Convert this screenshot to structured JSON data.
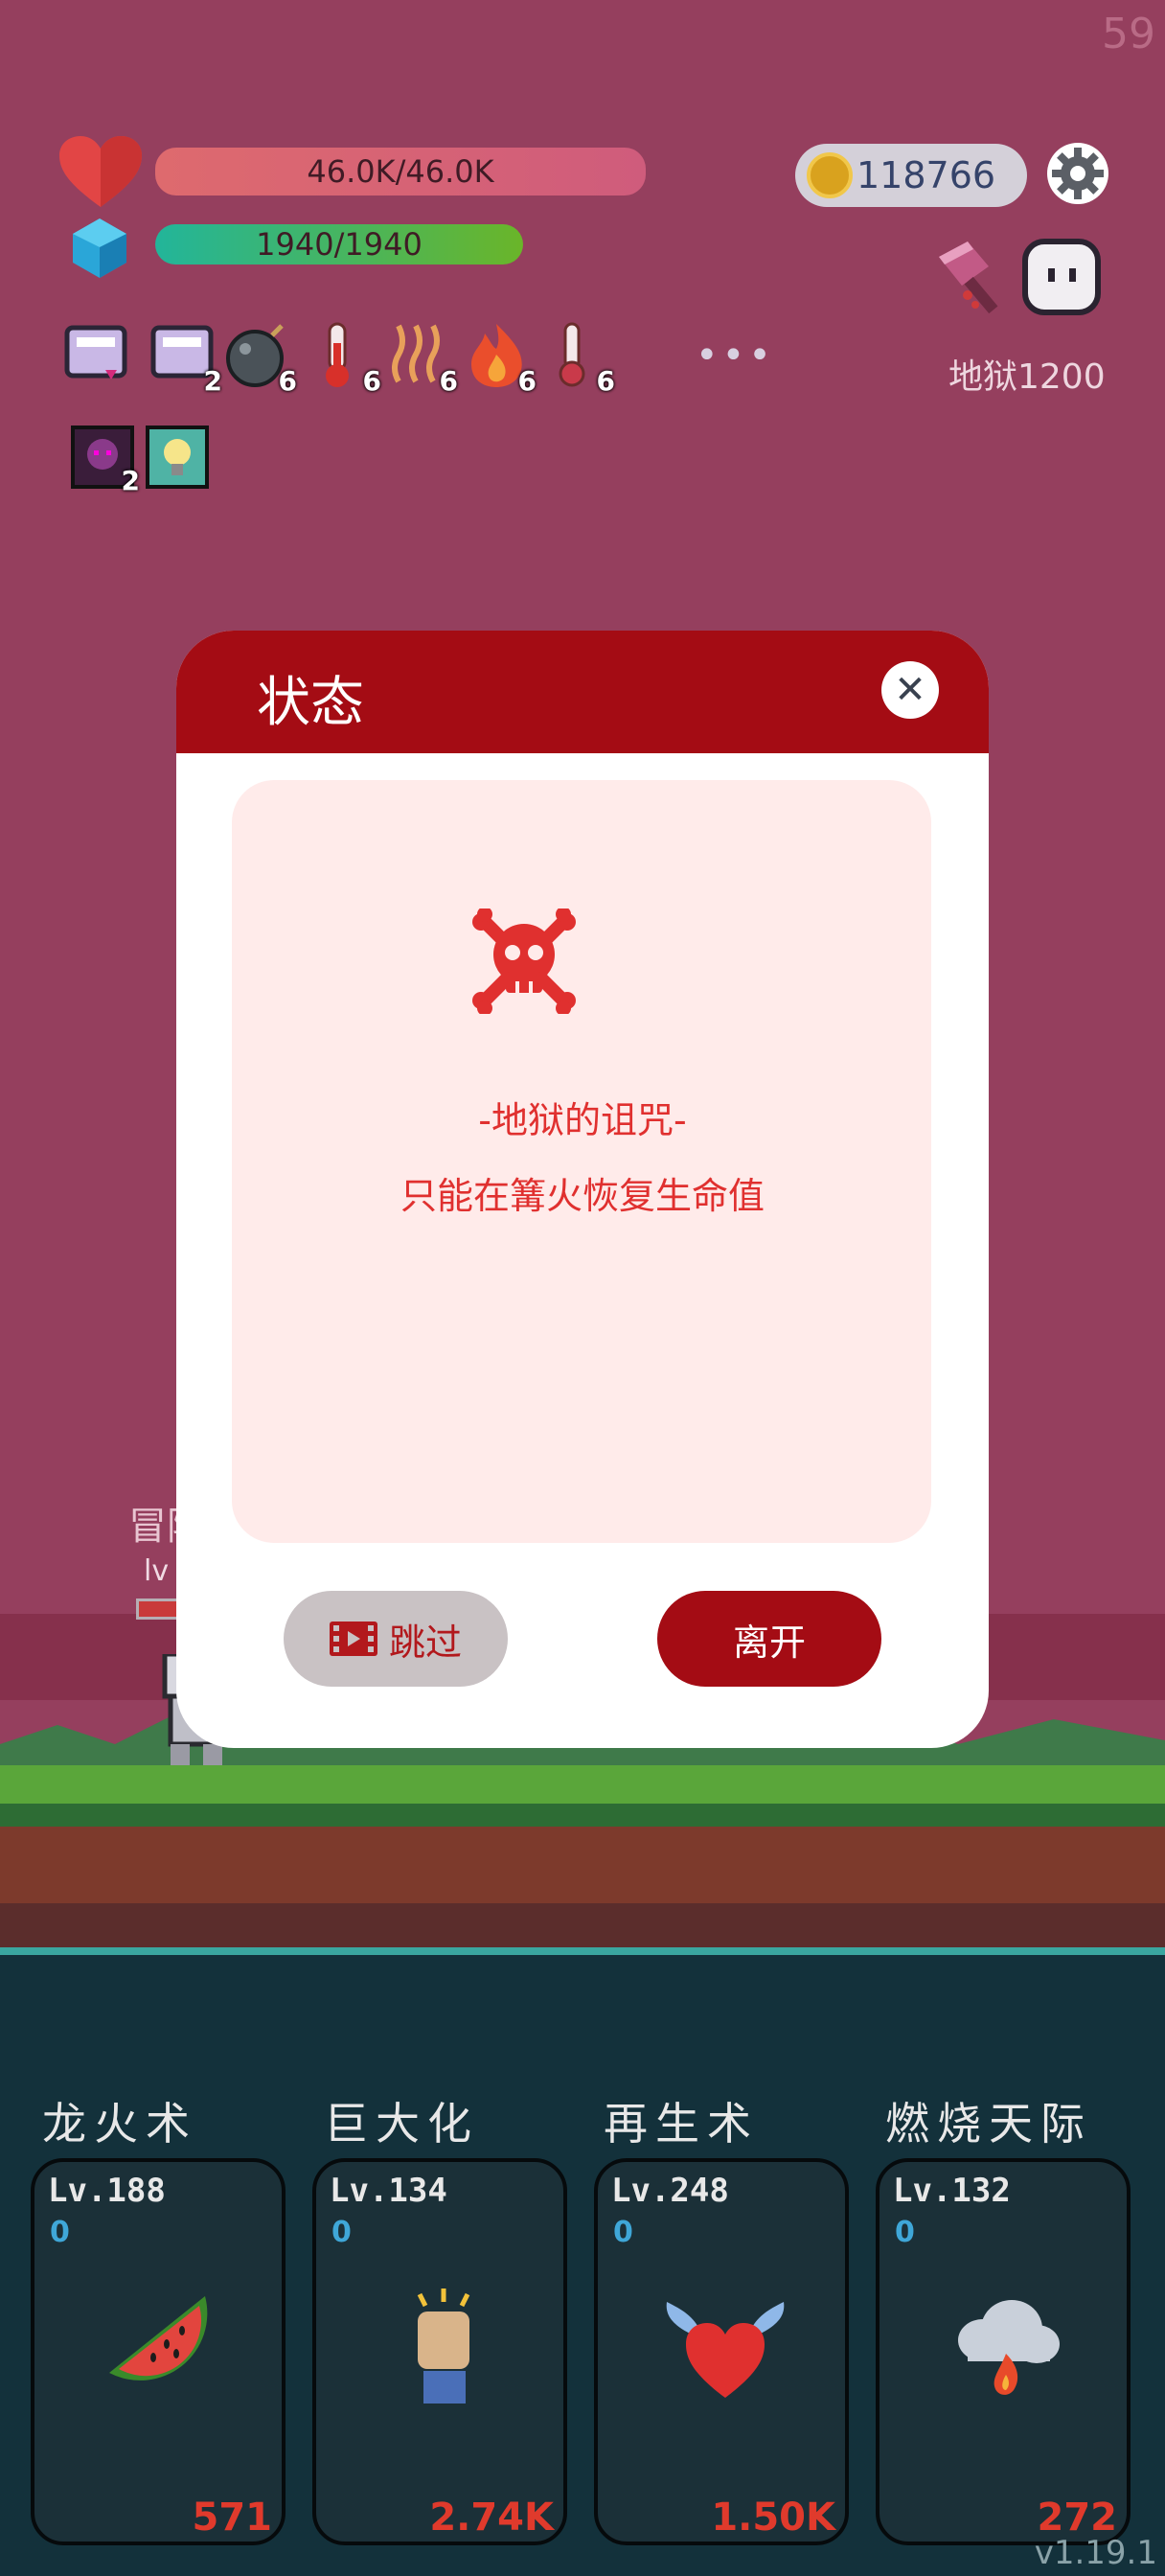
{
  "fps": "59",
  "version": "v1.19.1",
  "hud": {
    "hp_text": "46.0K/46.0K",
    "mp_text": "1940/1940",
    "coins": "118766",
    "hell_level": "地狱1200",
    "more": "•••"
  },
  "buffs_row1": [
    {
      "icon": "scroll-icon",
      "count": ""
    },
    {
      "icon": "scroll-icon",
      "count": "2"
    },
    {
      "icon": "bomb-icon",
      "count": "6"
    },
    {
      "icon": "thermometer-icon",
      "count": "6"
    },
    {
      "icon": "heat-wave-icon",
      "count": "6"
    },
    {
      "icon": "flame-icon",
      "count": "6"
    },
    {
      "icon": "cold-thermometer-icon",
      "count": "6"
    }
  ],
  "buffs_row2": [
    {
      "icon": "monster-card-icon",
      "count": "2"
    },
    {
      "icon": "lightbulb-icon",
      "count": ""
    }
  ],
  "npc": {
    "name": "冒险",
    "level": "lv"
  },
  "modal": {
    "title": "状态",
    "curse_title": "-地狱的诅咒-",
    "curse_desc": "只能在篝火恢复生命值",
    "skip_label": "跳过",
    "leave_label": "离开"
  },
  "skills": [
    {
      "name": "龙火术",
      "level": "Lv.188",
      "zero": "0",
      "cost": "571",
      "icon": "watermelon-icon"
    },
    {
      "name": "巨大化",
      "level": "Lv.134",
      "zero": "0",
      "cost": "2.74K",
      "icon": "fist-icon"
    },
    {
      "name": "再生术",
      "level": "Lv.248",
      "zero": "0",
      "cost": "1.50K",
      "icon": "winged-heart-icon"
    },
    {
      "name": "燃烧天际",
      "level": "Lv.132",
      "zero": "0",
      "cost": "272",
      "icon": "fire-cloud-icon"
    }
  ]
}
